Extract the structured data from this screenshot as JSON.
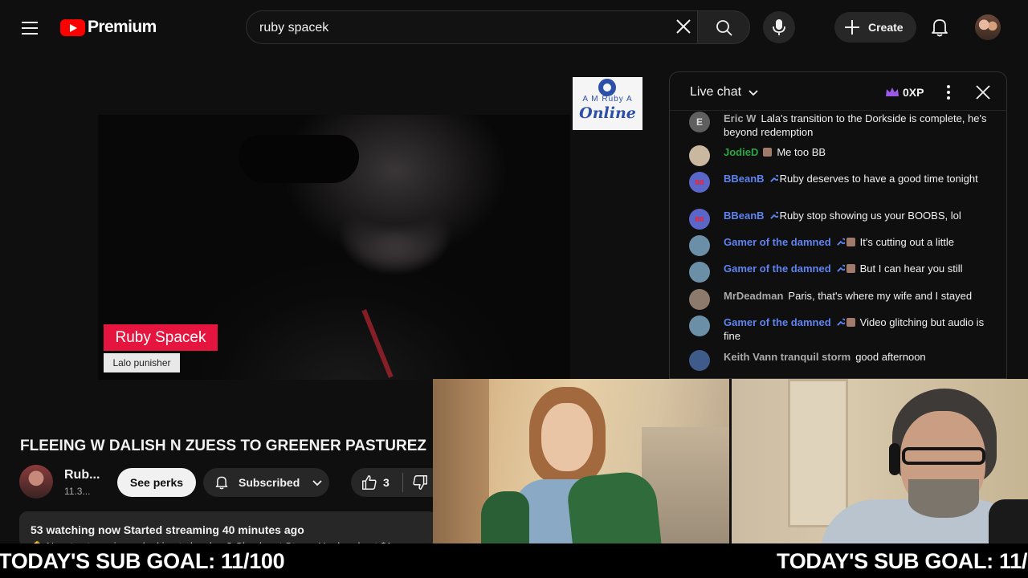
{
  "header": {
    "logo_text": "Premium",
    "search": {
      "value": "ruby spacek",
      "placeholder": "Search"
    },
    "create_label": "Create"
  },
  "player": {
    "name_tag": "Ruby Spacek",
    "sub_tag": "Lalo punisher",
    "channel_badge": {
      "top": "A M Ruby A",
      "script": "Online"
    }
  },
  "video": {
    "title": "FLEEING W DALISH N ZUESS TO GREENER PASTUREZ",
    "channel_name": "Rub...",
    "subscribers": "11.3...",
    "perks_label": "See perks",
    "subscribed_label": "Subscribed",
    "like_count": "3",
    "watching": "53 watching now  Started streaming 40 minutes ago",
    "description_preview": "🔔 New to streaming or looking to level up? Check out StreamYard and get $1"
  },
  "chat": {
    "title": "Live chat",
    "xp_label": "0XP",
    "messages": [
      {
        "author": "Eric W",
        "text": "Lala's transition to the Dorkside is complete, he's beyond redemption",
        "color": "#aaaaaa",
        "avatar": "E",
        "avatar_color": "#5f5f5f",
        "badges": ""
      },
      {
        "author": "JodieD",
        "text": "Me too BB",
        "color": "#2ba640",
        "avatar": "",
        "avatar_color": "#c9b7a0",
        "badges": "member"
      },
      {
        "author": "BBeanB",
        "text": "Ruby deserves to have a good time tonight",
        "color": "#5e84f1",
        "avatar": "BB",
        "avatar_color": "#5b66c9",
        "badges": "mod"
      },
      {
        "author": "BBeanB",
        "text": "Ruby stop showing us your BOOBS, lol",
        "color": "#5e84f1",
        "avatar": "BB",
        "avatar_color": "#5b66c9",
        "badges": "mod"
      },
      {
        "author": "Gamer of the damned",
        "text": "It's cutting out a little",
        "color": "#5e84f1",
        "avatar": "",
        "avatar_color": "#6a8fa6",
        "badges": "mod-member"
      },
      {
        "author": "Gamer of the damned",
        "text": "But I can hear you still",
        "color": "#5e84f1",
        "avatar": "",
        "avatar_color": "#6a8fa6",
        "badges": "mod-member"
      },
      {
        "author": "MrDeadman",
        "text": "Paris, that's where my wife and I stayed",
        "color": "#aaaaaa",
        "avatar": "",
        "avatar_color": "#8c7b6c",
        "badges": ""
      },
      {
        "author": "Gamer of the damned",
        "text": "Video glitching but audio is fine",
        "color": "#5e84f1",
        "avatar": "",
        "avatar_color": "#6a8fa6",
        "badges": "mod-member"
      },
      {
        "author": "Keith Vann tranquil storm",
        "text": "good afternoon",
        "color": "#aaaaaa",
        "avatar": "",
        "avatar_color": "#3f5b8a",
        "badges": ""
      }
    ]
  },
  "ticker": {
    "text": "TODAY'S SUB GOAL: 11/100"
  },
  "colors": {
    "brand_red": "#ff0000",
    "name_tag_pink": "#e5153f",
    "mod_blue": "#5e84f1",
    "member_green": "#2ba640",
    "xp_purple": "#9b59e6"
  }
}
